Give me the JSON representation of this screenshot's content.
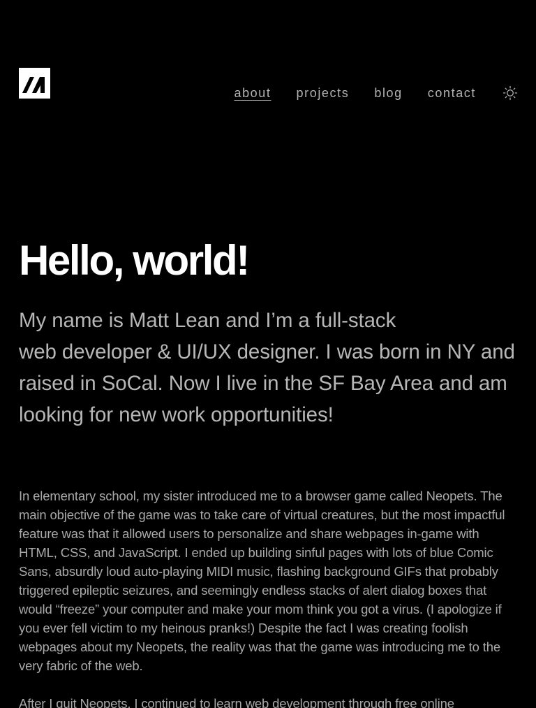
{
  "header": {
    "logo_icon": "brand-logo-icon",
    "nav": {
      "about": "about",
      "projects": "projects",
      "blog": "blog",
      "contact": "contact"
    },
    "theme_toggle_icon": "sun-icon"
  },
  "main": {
    "heading": "Hello, world!",
    "intro_line1": "My name is Matt Lean and I’m a full-stack",
    "intro_rest": "web developer & UI/UX designer. I was born in NY and raised in SoCal. Now I live in the SF Bay Area and am looking for new work opportunities!",
    "paragraphs": [
      "In elementary school, my sister introduced me to a browser game called Neopets. The main objective of the game was to take care of virtual creatures, but the most impactful feature was that it allowed users to personalize and share webpages in-game with HTML, CSS, and JavaScript. I ended up building sinful pages with lots of blue Comic Sans, absurdly loud auto-playing MIDI music, flashing background GIFs that probably triggered epileptic seizures, and seemingly endless stacks of alert dialog boxes that would “freeze” your computer and make your mom think you got a virus. (I apologize if you ever fell victim to my heinous pranks!) Despite the fact I was creating foolish webpages about my Neopets, the reality was that the game was introducing me to the very fabric of the web.",
      "After I quit Neopets, I continued to learn web development through free online"
    ]
  },
  "colors": {
    "background": "#000000",
    "heading": "#ffffff",
    "intro_text": "#b7b7b7",
    "body_text": "#a9a9a9",
    "nav_text": "#b3b3b3"
  }
}
